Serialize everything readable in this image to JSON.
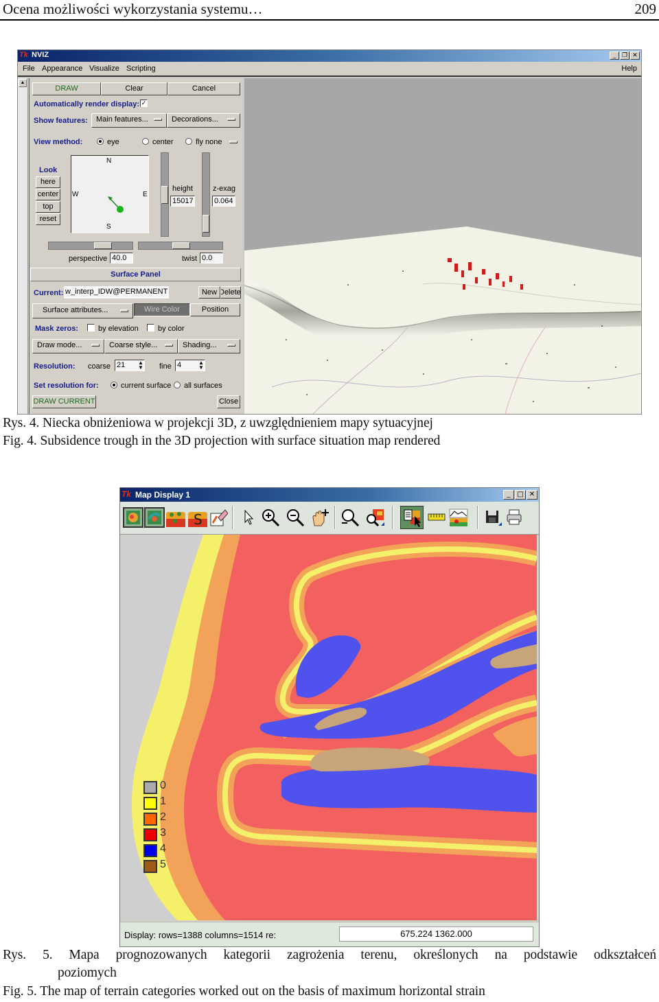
{
  "page_header": {
    "title": "Ocena możliwości wykorzystania systemu…",
    "page_number": "209"
  },
  "nviz": {
    "app_name": "NVIZ",
    "window_controls": [
      "_",
      "❐",
      "✕"
    ],
    "menu": [
      "File",
      "Appearance",
      "Visualize",
      "Scripting"
    ],
    "menu_right": "Help",
    "top_buttons": {
      "draw": "DRAW",
      "clear": "Clear",
      "cancel": "Cancel"
    },
    "auto_render": {
      "label": "Automatically render display:",
      "checked": true,
      "mark": "✓"
    },
    "show_features": {
      "label": "Show features:",
      "main": "Main features...",
      "decorations": "Decorations..."
    },
    "view_method": {
      "label": "View method:",
      "options": [
        "eye",
        "center",
        "fly none"
      ],
      "selected": "eye"
    },
    "look": {
      "label": "Look",
      "buttons": [
        "here",
        "center",
        "top",
        "reset"
      ]
    },
    "compass": {
      "n": "N",
      "s": "S",
      "e": "E",
      "w": "W"
    },
    "height": {
      "label": "height",
      "value": "15017"
    },
    "zexag": {
      "label": "z-exag",
      "value": "0.064"
    },
    "perspective": {
      "label": "perspective",
      "value": "40.0"
    },
    "twist": {
      "label": "twist",
      "value": "0.0"
    },
    "surface_panel": {
      "title": "Surface Panel",
      "current_label": "Current:",
      "current_value": "w_interp_IDW@PERMANENT",
      "new": "New",
      "delete": "Delete",
      "surface_attributes": "Surface attributes...",
      "wire_color": "Wire Color",
      "position": "Position",
      "mask_zeros_label": "Mask zeros:",
      "mask_by_elevation": "by elevation",
      "mask_by_color": "by color",
      "draw_mode": "Draw mode...",
      "coarse_style": "Coarse style...",
      "shading": "Shading...",
      "resolution_label": "Resolution:",
      "coarse_label": "coarse",
      "coarse_value": "21",
      "fine_label": "fine",
      "fine_value": "4",
      "set_resolution_label": "Set resolution for:",
      "res_options": [
        "current surface",
        "all surfaces"
      ],
      "res_selected": "current surface",
      "draw_current": "DRAW CURRENT",
      "close": "Close"
    }
  },
  "fig4": {
    "caption_pl": "Rys. 4. Niecka obniżeniowa w projekcji 3D, z uwzględnieniem mapy sytuacyjnej",
    "caption_en": "Fig. 4. Subsidence trough in the 3D projection with surface situation map rendered"
  },
  "mapdisplay": {
    "title": "Map Display 1",
    "window_controls": [
      "_",
      "□",
      "✕"
    ],
    "tools": [
      "display-active-layers",
      "redraw-all-layers",
      "add-raster",
      "add-vector-s",
      "erase-display",
      "pointer",
      "zoom-in",
      "zoom-out",
      "pan",
      "zoom-back",
      "zoom-to-region",
      "query",
      "measure",
      "profile",
      "save",
      "print"
    ],
    "status": "Display: rows=1388 columns=1514  re:",
    "coordinates": "675.224 1362.000",
    "legend": [
      {
        "label": "0",
        "color": "#aaaaaa"
      },
      {
        "label": "1",
        "color": "#ffff00"
      },
      {
        "label": "2",
        "color": "#ff6600"
      },
      {
        "label": "3",
        "color": "#ee0000"
      },
      {
        "label": "4",
        "color": "#0000ee"
      },
      {
        "label": "5",
        "color": "#a05a18"
      }
    ],
    "zone_colors": {
      "cat0": "#cfcfcf",
      "cat1": "#f5f06a",
      "cat2": "#f2a259",
      "cat3": "#f26060",
      "cat4": "#5052ee",
      "cat5": "#c8a47a"
    }
  },
  "fig5": {
    "caption_pl_line1": "Rys. 5. Mapa prognozowanych kategorii zagrożenia terenu, określonych na podstawie odkształceń",
    "caption_pl_line2": "poziomych",
    "caption_en": "Fig. 5. The map of terrain categories worked out on the basis of maximum horizontal strain"
  }
}
